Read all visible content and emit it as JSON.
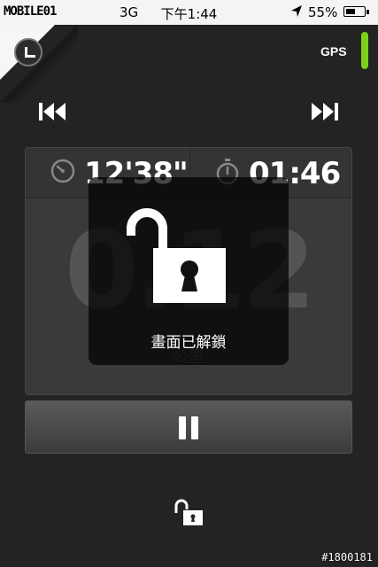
{
  "status_bar": {
    "brand": "MOBILE01",
    "network": "3G",
    "time": "下午1:44",
    "battery_percent": "55%",
    "battery_level": 0.55
  },
  "gps": {
    "label": "GPS",
    "color": "#7cd11a"
  },
  "stats": {
    "pace": "12'38\"",
    "duration": "01:46"
  },
  "distance": {
    "value": "0.12",
    "unit": "公里"
  },
  "overlay": {
    "message": "畫面已解鎖"
  },
  "icons": {
    "lock_screen": "corner-lock-icon",
    "prev": "previous-track-icon",
    "next": "next-track-icon",
    "pace": "speedometer-icon",
    "duration": "stopwatch-icon",
    "pause": "pause-icon",
    "unlock": "unlock-icon"
  },
  "watermark": "#1800181"
}
